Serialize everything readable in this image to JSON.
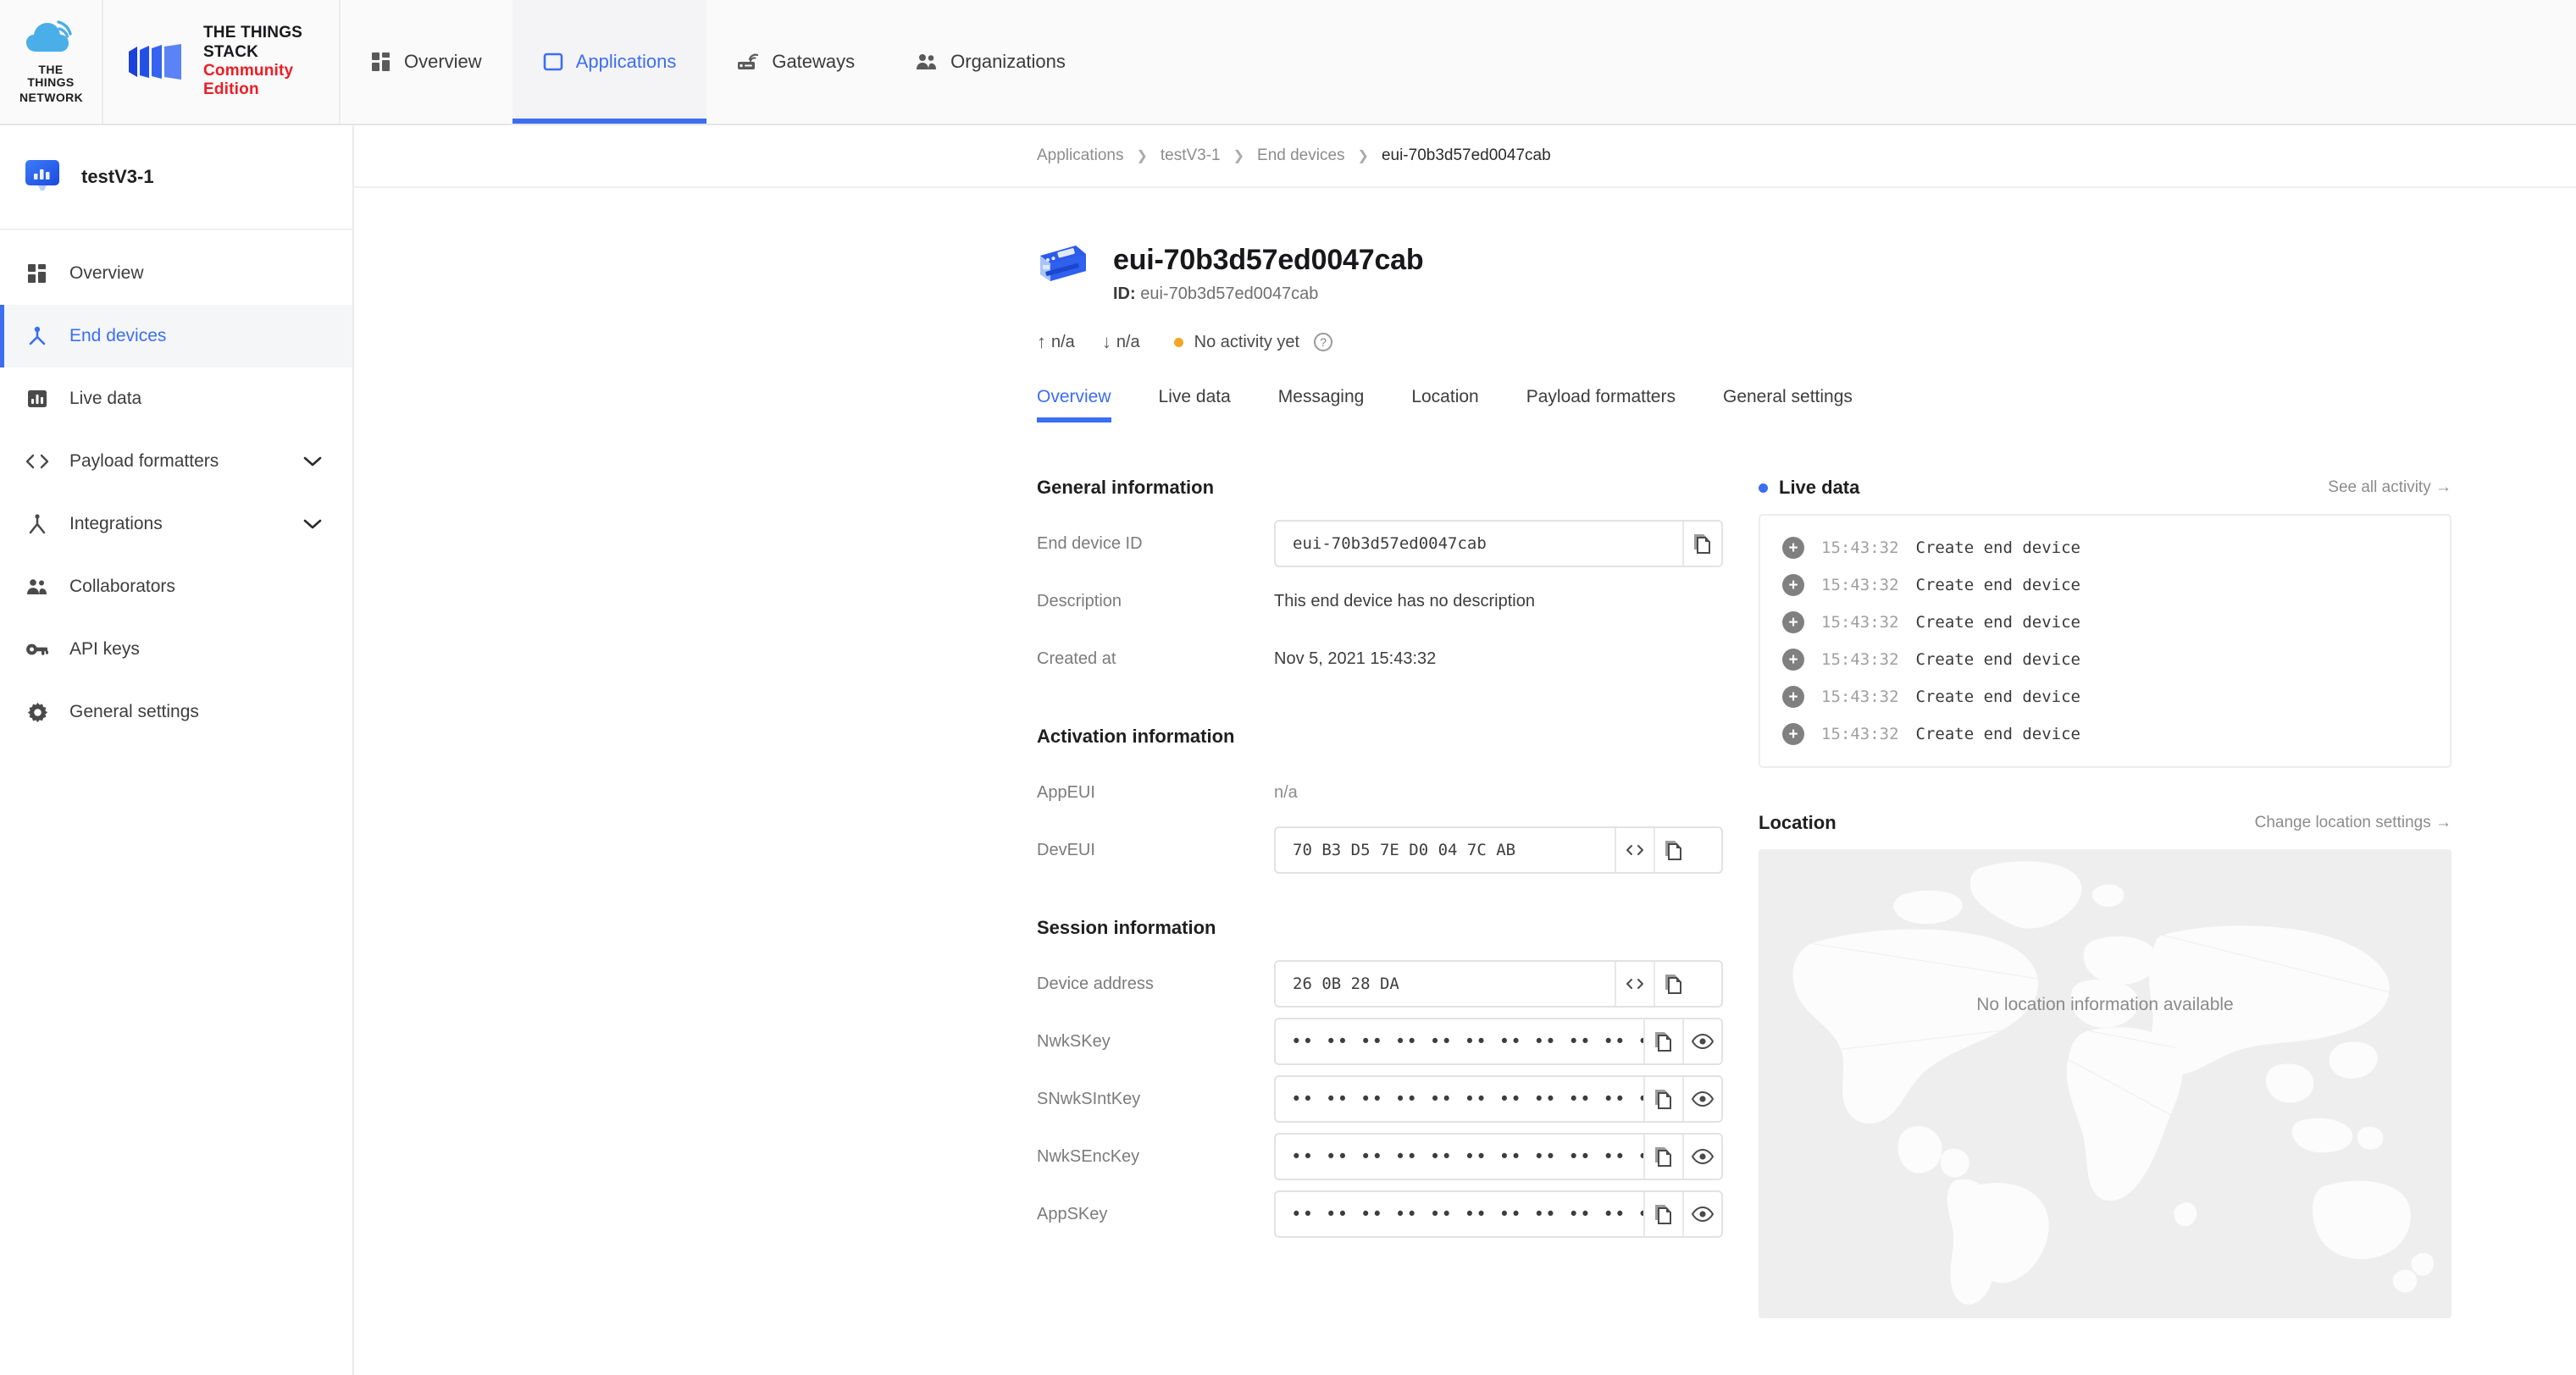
{
  "topbar": {
    "logo_alt": "The Things Network",
    "logo_words_line1": "THE THINGS",
    "logo_words_line2": "NETWORK",
    "brand_line1": "THE THINGS STACK",
    "brand_line2": "Community Edition",
    "nav": [
      {
        "label": "Overview",
        "icon": "grid-icon",
        "active": false
      },
      {
        "label": "Applications",
        "icon": "application-icon",
        "active": true
      },
      {
        "label": "Gateways",
        "icon": "gateway-icon",
        "active": false
      },
      {
        "label": "Organizations",
        "icon": "organizations-icon",
        "active": false
      }
    ]
  },
  "sidebar": {
    "app_name": "testV3-1",
    "app_icon": "application-avatar-icon",
    "items": [
      {
        "label": "Overview",
        "icon": "grid-icon",
        "active": false,
        "chevron": false
      },
      {
        "label": "End devices",
        "icon": "end-devices-icon",
        "active": true,
        "chevron": false
      },
      {
        "label": "Live data",
        "icon": "live-data-icon",
        "active": false,
        "chevron": false
      },
      {
        "label": "Payload formatters",
        "icon": "code-icon",
        "active": false,
        "chevron": true
      },
      {
        "label": "Integrations",
        "icon": "integrations-icon",
        "active": false,
        "chevron": true
      },
      {
        "label": "Collaborators",
        "icon": "collaborators-icon",
        "active": false,
        "chevron": false
      },
      {
        "label": "API keys",
        "icon": "key-icon",
        "active": false,
        "chevron": false
      },
      {
        "label": "General settings",
        "icon": "gear-icon",
        "active": false,
        "chevron": false
      }
    ]
  },
  "breadcrumb": [
    {
      "label": "Applications",
      "current": false
    },
    {
      "label": "testV3-1",
      "current": false
    },
    {
      "label": "End devices",
      "current": false
    },
    {
      "label": "eui-70b3d57ed0047cab",
      "current": true
    }
  ],
  "device": {
    "icon": "end-device-icon",
    "title": "eui-70b3d57ed0047cab",
    "id_label": "ID:",
    "id_value": "eui-70b3d57ed0047cab",
    "uplink": "n/a",
    "downlink": "n/a",
    "activity_status": "No activity yet",
    "activity_help": "?",
    "status_color": "#f5a623"
  },
  "tabs": [
    {
      "label": "Overview",
      "active": true
    },
    {
      "label": "Live data",
      "active": false
    },
    {
      "label": "Messaging",
      "active": false
    },
    {
      "label": "Location",
      "active": false
    },
    {
      "label": "Payload formatters",
      "active": false
    },
    {
      "label": "General settings",
      "active": false
    }
  ],
  "general_information": {
    "title": "General information",
    "rows": [
      {
        "label": "End device ID",
        "type": "boxed",
        "value": "eui-70b3d57ed0047cab",
        "buttons": [
          "copy-icon"
        ]
      },
      {
        "label": "Description",
        "type": "plain",
        "value": "This end device has no description"
      },
      {
        "label": "Created at",
        "type": "plain",
        "value": "Nov 5, 2021 15:43:32"
      }
    ]
  },
  "activation_information": {
    "title": "Activation information",
    "rows": [
      {
        "label": "AppEUI",
        "type": "plain-muted",
        "value": "n/a"
      },
      {
        "label": "DevEUI",
        "type": "boxed",
        "value": "70 B3 D5 7E D0 04 7C AB",
        "buttons": [
          "code-icon",
          "copy-icon"
        ]
      }
    ]
  },
  "session_information": {
    "title": "Session information",
    "rows": [
      {
        "label": "Device address",
        "type": "boxed",
        "value": "26 0B 28 DA",
        "buttons": [
          "code-icon",
          "copy-icon"
        ]
      },
      {
        "label": "NwkSKey",
        "type": "masked",
        "value": "•• •• •• •• •• •• •• •• •• •• •• •• •• •• •• ••",
        "buttons": [
          "copy-icon",
          "eye-icon"
        ]
      },
      {
        "label": "SNwkSIntKey",
        "type": "masked",
        "value": "•• •• •• •• •• •• •• •• •• •• •• •• •• •• •• ••",
        "buttons": [
          "copy-icon",
          "eye-icon"
        ]
      },
      {
        "label": "NwkSEncKey",
        "type": "masked",
        "value": "•• •• •• •• •• •• •• •• •• •• •• •• •• •• •• ••",
        "buttons": [
          "copy-icon",
          "eye-icon"
        ]
      },
      {
        "label": "AppSKey",
        "type": "masked",
        "value": "•• •• •• •• •• •• •• •• •• •• •• •• •• •• •• ••",
        "buttons": [
          "copy-icon",
          "eye-icon"
        ]
      }
    ]
  },
  "live_data": {
    "title": "Live data",
    "link": "See all activity →",
    "dot_color": "#3b6ef3",
    "entries": [
      {
        "icon": "plus-circle-icon",
        "time": "15:43:32",
        "message": "Create end device"
      },
      {
        "icon": "plus-circle-icon",
        "time": "15:43:32",
        "message": "Create end device"
      },
      {
        "icon": "plus-circle-icon",
        "time": "15:43:32",
        "message": "Create end device"
      },
      {
        "icon": "plus-circle-icon",
        "time": "15:43:32",
        "message": "Create end device"
      },
      {
        "icon": "plus-circle-icon",
        "time": "15:43:32",
        "message": "Create end device"
      },
      {
        "icon": "plus-circle-icon",
        "time": "15:43:32",
        "message": "Create end device"
      }
    ]
  },
  "location": {
    "title": "Location",
    "link": "Change location settings →",
    "empty_text": "No location information available"
  }
}
